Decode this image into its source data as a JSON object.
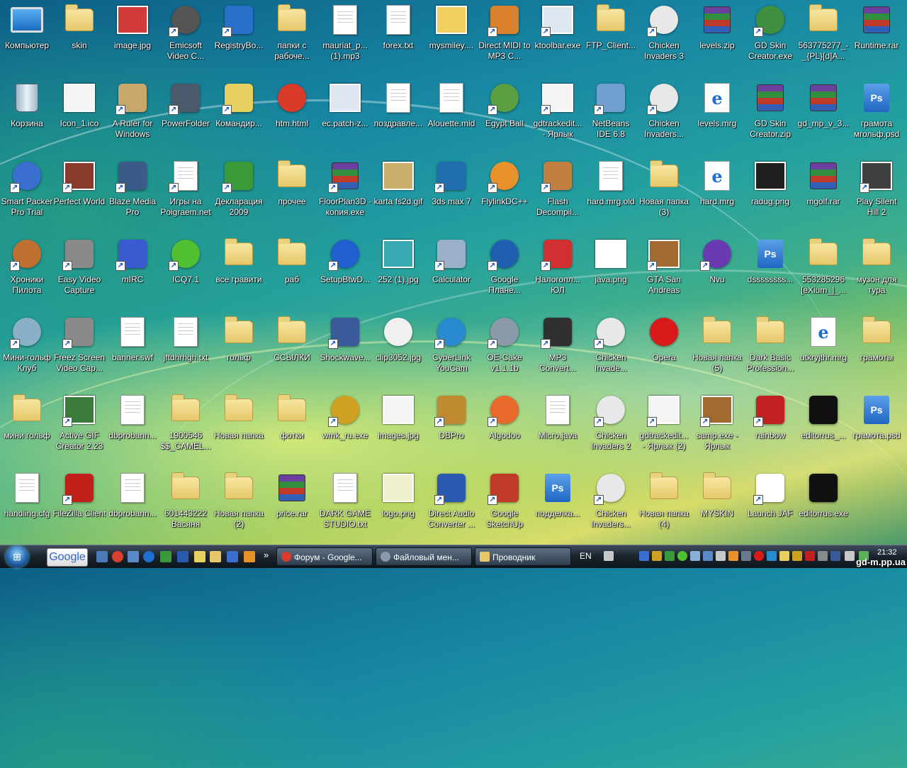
{
  "desktop": {
    "icons": [
      [
        {
          "label": "Компьютер",
          "icon": "computer-icon",
          "type": "monitor",
          "shortcut": false
        },
        {
          "label": "skin",
          "icon": "folder-icon",
          "type": "folder",
          "shortcut": false
        },
        {
          "label": "image.jpg",
          "icon": "image-icon",
          "type": "img",
          "color": "#d33a3a",
          "shortcut": false
        },
        {
          "label": "Emicsoft Video C...",
          "icon": "film-reel-icon",
          "type": "round",
          "color": "#555555",
          "shortcut": true
        },
        {
          "label": "RegistryBo...",
          "icon": "registry-tool-icon",
          "type": "box",
          "color": "#2a6fc9",
          "shortcut": true
        },
        {
          "label": "папки с рабоче...",
          "icon": "folder-icon",
          "type": "folder",
          "shortcut": false
        },
        {
          "label": "mauriat_p...(1).mp3",
          "icon": "mp3-file-icon",
          "type": "doc",
          "shortcut": false
        },
        {
          "label": "forex.txt",
          "icon": "text-file-icon",
          "type": "doc",
          "shortcut": false
        },
        {
          "label": "mysmiley....",
          "icon": "smiley-chef-icon",
          "type": "img",
          "color": "#f0d060",
          "shortcut": false
        },
        {
          "label": "Direct MIDI to MP3 C...",
          "icon": "audio-converter-icon",
          "type": "box",
          "color": "#d9822b",
          "shortcut": true
        },
        {
          "label": "ktoolbar.exe",
          "icon": "window-app-icon",
          "type": "img",
          "color": "#dfe8f0",
          "shortcut": true
        },
        {
          "label": "FTP_Client...",
          "icon": "folder-icon",
          "type": "folder",
          "shortcut": false
        },
        {
          "label": "Chicken Invaders 3",
          "icon": "chicken-game-icon",
          "type": "round",
          "color": "#e8e8e8",
          "shortcut": true
        },
        {
          "label": "levels.zip",
          "icon": "archive-icon",
          "type": "rar",
          "shortcut": false
        },
        {
          "label": "GD Skin Creator.exe",
          "icon": "bike-game-icon",
          "type": "round",
          "color": "#3f8f3f",
          "shortcut": true
        },
        {
          "label": "563775277_-_{PL}[d]A...",
          "icon": "folder-icon",
          "type": "folder",
          "shortcut": false
        },
        {
          "label": "Runtime.rar",
          "icon": "archive-icon",
          "type": "rar",
          "shortcut": false
        }
      ],
      [
        {
          "label": "Корзина",
          "icon": "recycle-bin-icon",
          "type": "bin",
          "shortcut": false
        },
        {
          "label": "Icon_1.ico",
          "icon": "bike-icon",
          "type": "img",
          "color": "#f4f4f4",
          "shortcut": false
        },
        {
          "label": "A Ruler for Windows",
          "icon": "ruler-icon",
          "type": "box",
          "color": "#c8a76a",
          "shortcut": true
        },
        {
          "label": "PowerFolder",
          "icon": "powerfolder-icon",
          "type": "box",
          "color": "#4a5a6a",
          "shortcut": true
        },
        {
          "label": "Командир...",
          "icon": "commander-icon",
          "type": "box",
          "color": "#e8d060",
          "shortcut": true
        },
        {
          "label": "htm.html",
          "icon": "chrome-icon",
          "type": "round",
          "color": "#d93a2a",
          "shortcut": false
        },
        {
          "label": "ec.patch-z...",
          "icon": "window-app-icon",
          "type": "img",
          "color": "#dfe8f0",
          "shortcut": false
        },
        {
          "label": "поздравле...",
          "icon": "text-file-icon",
          "type": "doc",
          "shortcut": false
        },
        {
          "label": "Alouette.mid",
          "icon": "midi-file-icon",
          "type": "doc",
          "shortcut": false
        },
        {
          "label": "Egypt Ball",
          "icon": "egypt-ball-icon",
          "type": "round",
          "color": "#5aa040",
          "shortcut": true
        },
        {
          "label": "gdtrackedit... - Ярлык",
          "icon": "bike-icon",
          "type": "img",
          "color": "#f4f4f4",
          "shortcut": true
        },
        {
          "label": "NetBeans IDE 6.8",
          "icon": "netbeans-cube-icon",
          "type": "box",
          "color": "#6fa0d0",
          "shortcut": true
        },
        {
          "label": "Chicken Invaders...",
          "icon": "chicken-game-icon",
          "type": "round",
          "color": "#e8e8e8",
          "shortcut": true
        },
        {
          "label": "levels.mrg",
          "icon": "ie-file-icon",
          "type": "ie",
          "shortcut": false
        },
        {
          "label": "GD Skin Creator.zip",
          "icon": "archive-icon",
          "type": "rar",
          "shortcut": false
        },
        {
          "label": "gd_mp_v_3...",
          "icon": "archive-icon",
          "type": "rar",
          "shortcut": false
        },
        {
          "label": "грамота мгольф.psd",
          "icon": "psd-file-icon",
          "type": "psd",
          "shortcut": false
        }
      ],
      [
        {
          "label": "Smart Packer Pro Trial",
          "icon": "gear-icon",
          "type": "round",
          "color": "#3a6fd0",
          "shortcut": true
        },
        {
          "label": "Perfect World",
          "icon": "game-character-icon",
          "type": "img",
          "color": "#8a3a2a",
          "shortcut": true
        },
        {
          "label": "Blaze Media Pro",
          "icon": "media-app-icon",
          "type": "box",
          "color": "#3a5a8a",
          "shortcut": true
        },
        {
          "label": "Игры на Poigraem.net",
          "icon": "text-file-icon",
          "type": "doc",
          "shortcut": true
        },
        {
          "label": "Декларация 2009",
          "icon": "declaration-icon",
          "type": "box",
          "color": "#3a9a3a",
          "shortcut": true
        },
        {
          "label": "прочее",
          "icon": "folder-icon",
          "type": "folder",
          "shortcut": false
        },
        {
          "label": "FloorPlan3D - копия.exe",
          "icon": "floorplan-icon",
          "type": "rar",
          "shortcut": true
        },
        {
          "label": "karta fs2d.gif",
          "icon": "map-image-icon",
          "type": "img",
          "color": "#c9b06a",
          "shortcut": false
        },
        {
          "label": "3ds max 7",
          "icon": "3dsmax-icon",
          "type": "box",
          "color": "#1f6fb0",
          "shortcut": true
        },
        {
          "label": "FlylinkDC++",
          "icon": "flylink-icon",
          "type": "round",
          "color": "#e8902a",
          "shortcut": true
        },
        {
          "label": "Flash Decompil...",
          "icon": "flash-decompiler-icon",
          "type": "box",
          "color": "#c08040",
          "shortcut": true
        },
        {
          "label": "hard.mrg.old",
          "icon": "blank-file-icon",
          "type": "doc",
          "shortcut": false
        },
        {
          "label": "Новая папка (3)",
          "icon": "folder-icon",
          "type": "folder",
          "shortcut": false
        },
        {
          "label": "hard.mrg",
          "icon": "ie-file-icon",
          "type": "ie",
          "shortcut": false
        },
        {
          "label": "radug.png",
          "icon": "rainbow-image-icon",
          "type": "img",
          "color": "#202020",
          "shortcut": false
        },
        {
          "label": "mgolf.rar",
          "icon": "archive-icon",
          "type": "rar",
          "shortcut": false
        },
        {
          "label": "Play Silent Hill 2",
          "icon": "silent-hill-icon",
          "type": "img",
          "color": "#404040",
          "shortcut": true
        }
      ],
      [
        {
          "label": "Хроники Пилота",
          "icon": "pilot-game-icon",
          "type": "round",
          "color": "#c07030",
          "shortcut": true
        },
        {
          "label": "Easy Video Capture",
          "icon": "camera-icon",
          "type": "box",
          "color": "#8a8a8a",
          "shortcut": true
        },
        {
          "label": "mIRC",
          "icon": "mirc-icon",
          "type": "box",
          "color": "#3a5ad0",
          "shortcut": true
        },
        {
          "label": "ICQ7.1",
          "icon": "icq-flower-icon",
          "type": "round",
          "color": "#50c030",
          "shortcut": true
        },
        {
          "label": "все гравити",
          "icon": "folder-icon",
          "type": "folder",
          "shortcut": false
        },
        {
          "label": "раб",
          "icon": "folder-icon",
          "type": "folder",
          "shortcut": false
        },
        {
          "label": "SetupBtwD...",
          "icon": "bluetooth-icon",
          "type": "round",
          "color": "#1f5fd0",
          "shortcut": true
        },
        {
          "label": "252 (1).jpg",
          "icon": "image-icon",
          "type": "img",
          "color": "#3aa8b0",
          "shortcut": false
        },
        {
          "label": "Calculator",
          "icon": "calculator-icon",
          "type": "box",
          "color": "#9ab0c8",
          "shortcut": true
        },
        {
          "label": "Google Плане...",
          "icon": "google-earth-icon",
          "type": "round",
          "color": "#1f5fb0",
          "shortcut": true
        },
        {
          "label": "Налогопл... ЮЛ",
          "icon": "tax-app-icon",
          "type": "box",
          "color": "#d03030",
          "shortcut": true
        },
        {
          "label": "java.png",
          "icon": "java-icon",
          "type": "img",
          "color": "#ffffff",
          "shortcut": false
        },
        {
          "label": "GTA San Andreas",
          "icon": "gta-icon",
          "type": "img",
          "color": "#a06a30",
          "shortcut": true
        },
        {
          "label": "Nvu",
          "icon": "nvu-icon",
          "type": "round",
          "color": "#6a3ab0",
          "shortcut": true
        },
        {
          "label": "dssssssss...",
          "icon": "psd-file-icon",
          "type": "psd",
          "shortcut": false
        },
        {
          "label": "553285296 [eXium_]_...",
          "icon": "folder-icon",
          "type": "folder",
          "shortcut": false
        },
        {
          "label": "музон для тура",
          "icon": "folder-icon",
          "type": "folder",
          "shortcut": false
        }
      ],
      [
        {
          "label": "Мини-гольф Клуб",
          "icon": "golf-game-icon",
          "type": "round",
          "color": "#8ab0c8",
          "shortcut": true
        },
        {
          "label": "Freez Screen Video Cap...",
          "icon": "camera-icon",
          "type": "box",
          "color": "#8a8a8a",
          "shortcut": true
        },
        {
          "label": "banner.swf",
          "icon": "flash-file-icon",
          "type": "doc",
          "shortcut": false
        },
        {
          "label": "jftdhrhgh.txt",
          "icon": "text-file-icon",
          "type": "doc",
          "shortcut": false
        },
        {
          "label": "гольф",
          "icon": "folder-icon",
          "type": "folder",
          "shortcut": false
        },
        {
          "label": "ССЫЛКИ",
          "icon": "folder-icon",
          "type": "folder",
          "shortcut": false
        },
        {
          "label": "Shockwave...",
          "icon": "shockwave-icon",
          "type": "box",
          "color": "#3a5a9a",
          "shortcut": true
        },
        {
          "label": "clip3052.jpg",
          "icon": "soccer-ball-icon",
          "type": "round",
          "color": "#f0f0f0",
          "shortcut": false
        },
        {
          "label": "CyberLink YouCam",
          "icon": "webcam-icon",
          "type": "round",
          "color": "#2a8ad0",
          "shortcut": true
        },
        {
          "label": "OE-Cake v1.1.1b",
          "icon": "oe-cake-icon",
          "type": "round",
          "color": "#8a9aa8",
          "shortcut": true
        },
        {
          "label": "MP3 Convert...",
          "icon": "mp3-convert-icon",
          "type": "box",
          "color": "#303030",
          "shortcut": true
        },
        {
          "label": "Chicken Invade...",
          "icon": "chicken-game-icon",
          "type": "round",
          "color": "#e8e8e8",
          "shortcut": true
        },
        {
          "label": "Opera",
          "icon": "opera-icon",
          "type": "round",
          "color": "#d81a1a",
          "shortcut": false
        },
        {
          "label": "Новая папка (5)",
          "icon": "folder-icon",
          "type": "folder",
          "shortcut": false
        },
        {
          "label": "Dark Basic Profession...",
          "icon": "folder-icon",
          "type": "folder",
          "shortcut": false
        },
        {
          "label": "utkryjthr.mrg",
          "icon": "ie-file-icon",
          "type": "ie",
          "shortcut": false
        },
        {
          "label": "грамоты",
          "icon": "folder-icon",
          "type": "folder",
          "shortcut": false
        }
      ],
      [
        {
          "label": "мини гольф",
          "icon": "folder-icon",
          "type": "folder",
          "shortcut": false
        },
        {
          "label": "Active GIF Creator 2.23",
          "icon": "gif-creator-icon",
          "type": "img",
          "color": "#3a7a3a",
          "shortcut": true
        },
        {
          "label": "dbprobann...",
          "icon": "flash-file-icon",
          "type": "doc",
          "shortcut": false
        },
        {
          "label": "1900546 $$_CAMEL...",
          "icon": "folder-icon",
          "type": "folder",
          "shortcut": false
        },
        {
          "label": "Новая папка",
          "icon": "folder-icon",
          "type": "folder",
          "shortcut": false
        },
        {
          "label": "фотки",
          "icon": "folder-icon",
          "type": "folder",
          "shortcut": false
        },
        {
          "label": "wmk_ru.exe",
          "icon": "webmoney-icon",
          "type": "round",
          "color": "#d0a020",
          "shortcut": true
        },
        {
          "label": "images.jpg",
          "icon": "image-icon",
          "type": "img",
          "color": "#f4f4f4",
          "shortcut": false
        },
        {
          "label": "DBPro",
          "icon": "dbpro-icon",
          "type": "box",
          "color": "#c08a30",
          "shortcut": true
        },
        {
          "label": "Algodoo",
          "icon": "algodoo-icon",
          "type": "round",
          "color": "#e86a2a",
          "shortcut": true
        },
        {
          "label": "Micro.java",
          "icon": "text-file-icon",
          "type": "doc",
          "shortcut": false
        },
        {
          "label": "Chicken Invaders 2",
          "icon": "chicken-game-icon",
          "type": "round",
          "color": "#e8e8e8",
          "shortcut": true
        },
        {
          "label": "gdtrackedit... - Ярлык (2)",
          "icon": "bike-icon",
          "type": "img",
          "color": "#f4f4f4",
          "shortcut": true
        },
        {
          "label": "samp.exe - Ярлык",
          "icon": "gta-icon",
          "type": "img",
          "color": "#a06a30",
          "shortcut": true
        },
        {
          "label": "rainbow",
          "icon": "rainbow-arrow-icon",
          "type": "box",
          "color": "#c02020",
          "shortcut": true
        },
        {
          "label": "editorrus_...",
          "icon": "editor-icon",
          "type": "box",
          "color": "#101010",
          "shortcut": false
        },
        {
          "label": "грамота.psd",
          "icon": "psd-file-icon",
          "type": "psd",
          "shortcut": false
        }
      ],
      [
        {
          "label": "handling.cfg",
          "icon": "config-file-icon",
          "type": "doc",
          "shortcut": false
        },
        {
          "label": "FileZilla Client",
          "icon": "filezilla-icon",
          "type": "box",
          "color": "#c0201a",
          "shortcut": true
        },
        {
          "label": "dbprobann...",
          "icon": "flash-file-icon",
          "type": "doc",
          "shortcut": false
        },
        {
          "label": "601443222 Васяня",
          "icon": "folder-icon",
          "type": "folder",
          "shortcut": false
        },
        {
          "label": "Новая папка (2)",
          "icon": "folder-icon",
          "type": "folder",
          "shortcut": false
        },
        {
          "label": "price.rar",
          "icon": "archive-icon",
          "type": "rar",
          "shortcut": false
        },
        {
          "label": "DARK GAME STUDIO.txt",
          "icon": "text-file-icon",
          "type": "doc",
          "shortcut": false
        },
        {
          "label": "logo.png",
          "icon": "logo-image-icon",
          "type": "img",
          "color": "#f0f0d0",
          "shortcut": false
        },
        {
          "label": "Direct Audio Converter ...",
          "icon": "audio-converter-icon",
          "type": "box",
          "color": "#2a5ab0",
          "shortcut": true
        },
        {
          "label": "Google SketchUp",
          "icon": "sketchup-icon",
          "type": "box",
          "color": "#c03a2a",
          "shortcut": true
        },
        {
          "label": "подделка...",
          "icon": "psd-file-icon",
          "type": "psd",
          "shortcut": false
        },
        {
          "label": "Chicken Invaders...",
          "icon": "chicken-game-icon",
          "type": "round",
          "color": "#e8e8e8",
          "shortcut": true
        },
        {
          "label": "Новая папка (4)",
          "icon": "folder-icon",
          "type": "folder",
          "shortcut": false
        },
        {
          "label": "MYSKIN",
          "icon": "folder-icon",
          "type": "folder",
          "shortcut": false
        },
        {
          "label": "Launch JAF",
          "icon": "jaf-icon",
          "type": "box",
          "color": "#ffffff",
          "shortcut": true
        },
        {
          "label": "editorrus.exe",
          "icon": "editor-icon",
          "type": "box",
          "color": "#101010",
          "shortcut": false
        }
      ]
    ]
  },
  "taskbar": {
    "google_label": "Google",
    "buttons": [
      {
        "label": "Форум - Google...",
        "icon": "chrome-icon",
        "color": "#d93a2a"
      },
      {
        "label": "Файловый мен...",
        "icon": "loading-icon",
        "color": "#8a9aa8"
      },
      {
        "label": "Проводник",
        "icon": "folder-icon",
        "color": "#e6c76a"
      }
    ],
    "language": "EN",
    "clock": "21:32",
    "overflow_chevron": "»"
  },
  "watermark": "gd-m.pp.ua"
}
